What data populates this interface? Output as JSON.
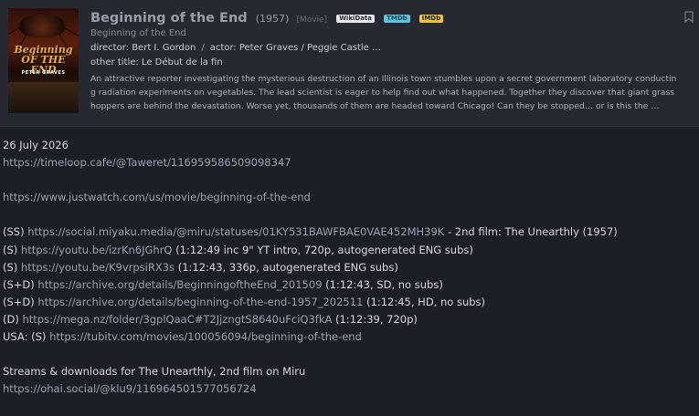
{
  "movie": {
    "title": "Beginning of the End",
    "year": "(1957)",
    "kind": "[Movie]",
    "badges": {
      "wikidata": "WikiData",
      "tmdb": "TMDb",
      "imdb": "IMDb"
    },
    "subtitle": "Beginning of the End",
    "director": "director: Bert I. Gordon",
    "actor": "actor: Peter Graves / Peggie Castle …",
    "other_title": "other title: Le Début de la fin",
    "description": "An attractive reporter investigating the mysterious destruction of an Illinois town stumbles upon a secret government laboratory conducting radiation experiments on vegetables. The lead scientist is eager to help find out what happened. Together they discover that giant grasshoppers are behind the devastation. Worse yet, thousands of them are headed toward Chicago! Can they be stopped… or is this the …",
    "poster_text": {
      "title": "Beginning OF THE END",
      "tagline": "PETER GRAVES"
    }
  },
  "post": {
    "date": "26 July 2026",
    "timeloop_link": "https://timeloop.cafe/@Taweret/116959586509098347",
    "justwatch_link": "https://www.justwatch.com/us/movie/beginning-of-the-end",
    "lines": [
      {
        "prefix": "(SS) ",
        "link": "https://social.miyaku.media/@miru/statuses/01KY531BAWFBAE0VAE452MH39K",
        "suffix": " - 2nd film: The Unearthly (1957)"
      },
      {
        "prefix": "(S) ",
        "link": "https://youtu.be/izrKn6JGhrQ",
        "suffix": " (1:12:49 inc 9\" YT intro, 720p, autogenerated ENG subs)"
      },
      {
        "prefix": "(S) ",
        "link": "https://youtu.be/K9vrpsiRX3s",
        "suffix": " (1:12:43, 336p, autogenerated ENG subs)"
      },
      {
        "prefix": "(S+D) ",
        "link": "https://archive.org/details/BeginningoftheEnd_201509",
        "suffix": " (1:12:43, SD, no subs)"
      },
      {
        "prefix": "(S+D) ",
        "link": "https://archive.org/details/beginning-of-the-end-1957_202511",
        "suffix": " (1:12:45, HD, no subs)"
      },
      {
        "prefix": "(D) ",
        "link": "https://mega.nz/folder/3gplQaaC#T2JjzngtS8640uFciQ3fkA",
        "suffix": " (1:12:39, 720p)"
      },
      {
        "prefix": "USA: (S) ",
        "link": "https://tubitv.com/movies/100056094/beginning-of-the-end",
        "suffix": ""
      }
    ],
    "streams_heading": "Streams & downloads for The Unearthly, 2nd film on Miru",
    "ohai_link": "https://ohai.social/@klu9/116964501577056724"
  }
}
